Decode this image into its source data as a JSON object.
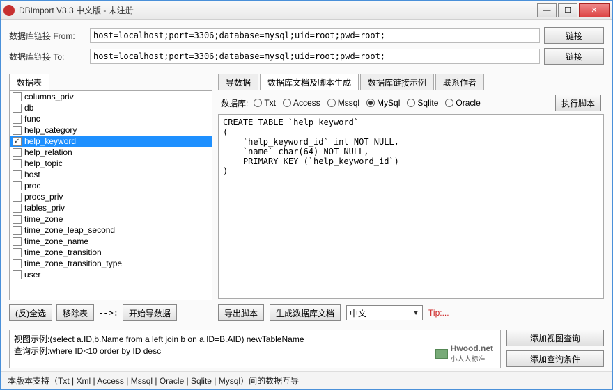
{
  "window": {
    "title": "DBImport V3.3 中文版 - 未注册"
  },
  "conn": {
    "from_label": "数据库链接 From:",
    "to_label": "数据库链接 To:",
    "from_value": "host=localhost;port=3306;database=mysql;uid=root;pwd=root;",
    "to_value": "host=localhost;port=3306;database=mysql;uid=root;pwd=root;",
    "connect_btn": "链接"
  },
  "left": {
    "tab": "数据表",
    "select_all_btn": "(反)全选",
    "remove_btn": "移除表",
    "arrow": "-->:",
    "start_btn": "开始导数据",
    "tables": [
      {
        "name": "columns_priv",
        "checked": false
      },
      {
        "name": "db",
        "checked": false
      },
      {
        "name": "func",
        "checked": false
      },
      {
        "name": "help_category",
        "checked": false
      },
      {
        "name": "help_keyword",
        "checked": true,
        "selected": true
      },
      {
        "name": "help_relation",
        "checked": false
      },
      {
        "name": "help_topic",
        "checked": false
      },
      {
        "name": "host",
        "checked": false
      },
      {
        "name": "proc",
        "checked": false
      },
      {
        "name": "procs_priv",
        "checked": false
      },
      {
        "name": "tables_priv",
        "checked": false
      },
      {
        "name": "time_zone",
        "checked": false
      },
      {
        "name": "time_zone_leap_second",
        "checked": false
      },
      {
        "name": "time_zone_name",
        "checked": false
      },
      {
        "name": "time_zone_transition",
        "checked": false
      },
      {
        "name": "time_zone_transition_type",
        "checked": false
      },
      {
        "name": "user",
        "checked": false
      }
    ]
  },
  "right": {
    "tabs": [
      "导数据",
      "数据库文档及脚本生成",
      "数据库链接示例",
      "联系作者"
    ],
    "active_tab": 1,
    "db_label": "数据库:",
    "db_types": [
      "Txt",
      "Access",
      "Mssql",
      "MySql",
      "Sqlite",
      "Oracle"
    ],
    "db_selected": "MySql",
    "exec_btn": "执行脚本",
    "script": "CREATE TABLE `help_keyword`\n(\n    `help_keyword_id` int NOT NULL,\n    `name` char(64) NOT NULL,\n    PRIMARY KEY (`help_keyword_id`)\n)",
    "export_btn": "导出脚本",
    "gendoc_btn": "生成数据库文档",
    "lang_value": "中文",
    "tip": "Tip:..."
  },
  "examples": {
    "line1": "视图示例:(select a.ID,b.Name from a left join b on a.ID=B.AID) newTableName",
    "line2": "查询示例:where ID<10 order by ID desc",
    "logo": "Hwood.net",
    "logo_sub": "小人人标准"
  },
  "side": {
    "add_view_btn": "添加视图查询",
    "add_cond_btn": "添加查询条件"
  },
  "footer": "本版本支持（Txt | Xml | Access | Mssql | Oracle | Sqlite | Mysql）间的数据互导"
}
